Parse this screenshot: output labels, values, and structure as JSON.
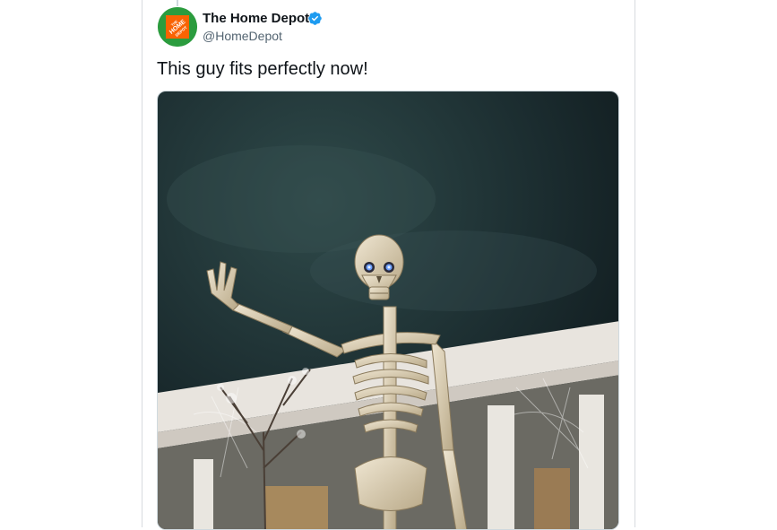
{
  "tweet": {
    "author_name": "The Home Depot",
    "author_handle": "@HomeDepot",
    "verified": true,
    "avatar_icon": "home-depot-logo-icon",
    "avatar_text": "THE HOME DEPOT",
    "text": "This guy fits perfectly now!",
    "media_description": "giant-skeleton-halloween-decoration-photo"
  },
  "colors": {
    "brand_orange": "#f96302",
    "avatar_green": "#2b9c3e",
    "verified_blue": "#1d9bf0",
    "text": "#0f1419",
    "muted": "#536471"
  }
}
